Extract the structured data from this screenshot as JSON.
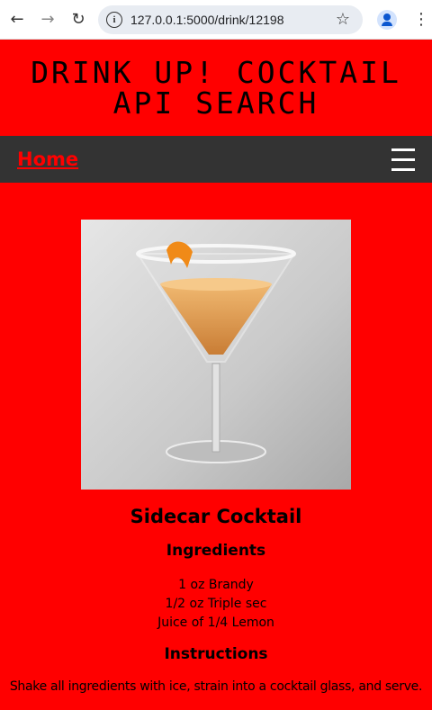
{
  "browser": {
    "url": "127.0.0.1:5000/drink/12198"
  },
  "site": {
    "title_line1": "DRINK UP! COCKTAIL",
    "title_line2": "API SEARCH",
    "nav_home": "Home"
  },
  "drink": {
    "name": "Sidecar Cocktail",
    "image_alt": "Sidecar Cocktail",
    "ingredients_heading": "Ingredients",
    "ingredients": [
      "1 oz Brandy",
      "1/2 oz Triple sec",
      "Juice of 1/4 Lemon"
    ],
    "instructions_heading": "Instructions",
    "instructions": "Shake all ingredients with ice, strain into a cocktail glass, and serve."
  },
  "colors": {
    "page_bg": "#ff0000",
    "navbar_bg": "#333333",
    "home_link": "#ff0000"
  },
  "icons": [
    "back-arrow-icon",
    "forward-arrow-icon",
    "reload-icon",
    "info-icon",
    "star-icon",
    "profile-icon",
    "more-menu-icon",
    "hamburger-menu-icon"
  ]
}
